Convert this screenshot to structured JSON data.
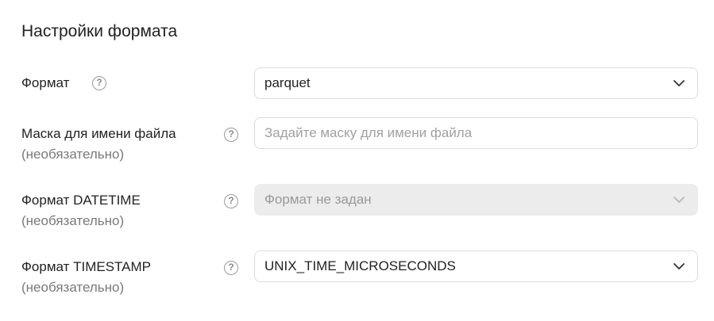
{
  "section": {
    "title": "Настройки формата"
  },
  "fields": {
    "format": {
      "label": "Формат",
      "value": "parquet",
      "help_icon": "question-circle-icon",
      "chevron_icon": "chevron-down-icon"
    },
    "mask": {
      "label": "Маска для имени файла",
      "optional": "(необязательно)",
      "placeholder": "Задайте маску для имени файла",
      "value": "",
      "help_icon": "question-circle-icon"
    },
    "datetime": {
      "label": "Формат DATETIME",
      "optional": "(необязательно)",
      "value": "Формат не задан",
      "disabled": true,
      "help_icon": "question-circle-icon",
      "chevron_icon": "chevron-down-icon"
    },
    "timestamp": {
      "label": "Формат TIMESTAMP",
      "optional": "(необязательно)",
      "value": "UNIX_TIME_MICROSECONDS",
      "help_icon": "question-circle-icon",
      "chevron_icon": "chevron-down-icon"
    }
  },
  "colors": {
    "text": "#222222",
    "secondary_text": "#7a7a7a",
    "border": "#dcdcdc",
    "disabled_bg": "#ececec"
  },
  "help_glyph": "?"
}
